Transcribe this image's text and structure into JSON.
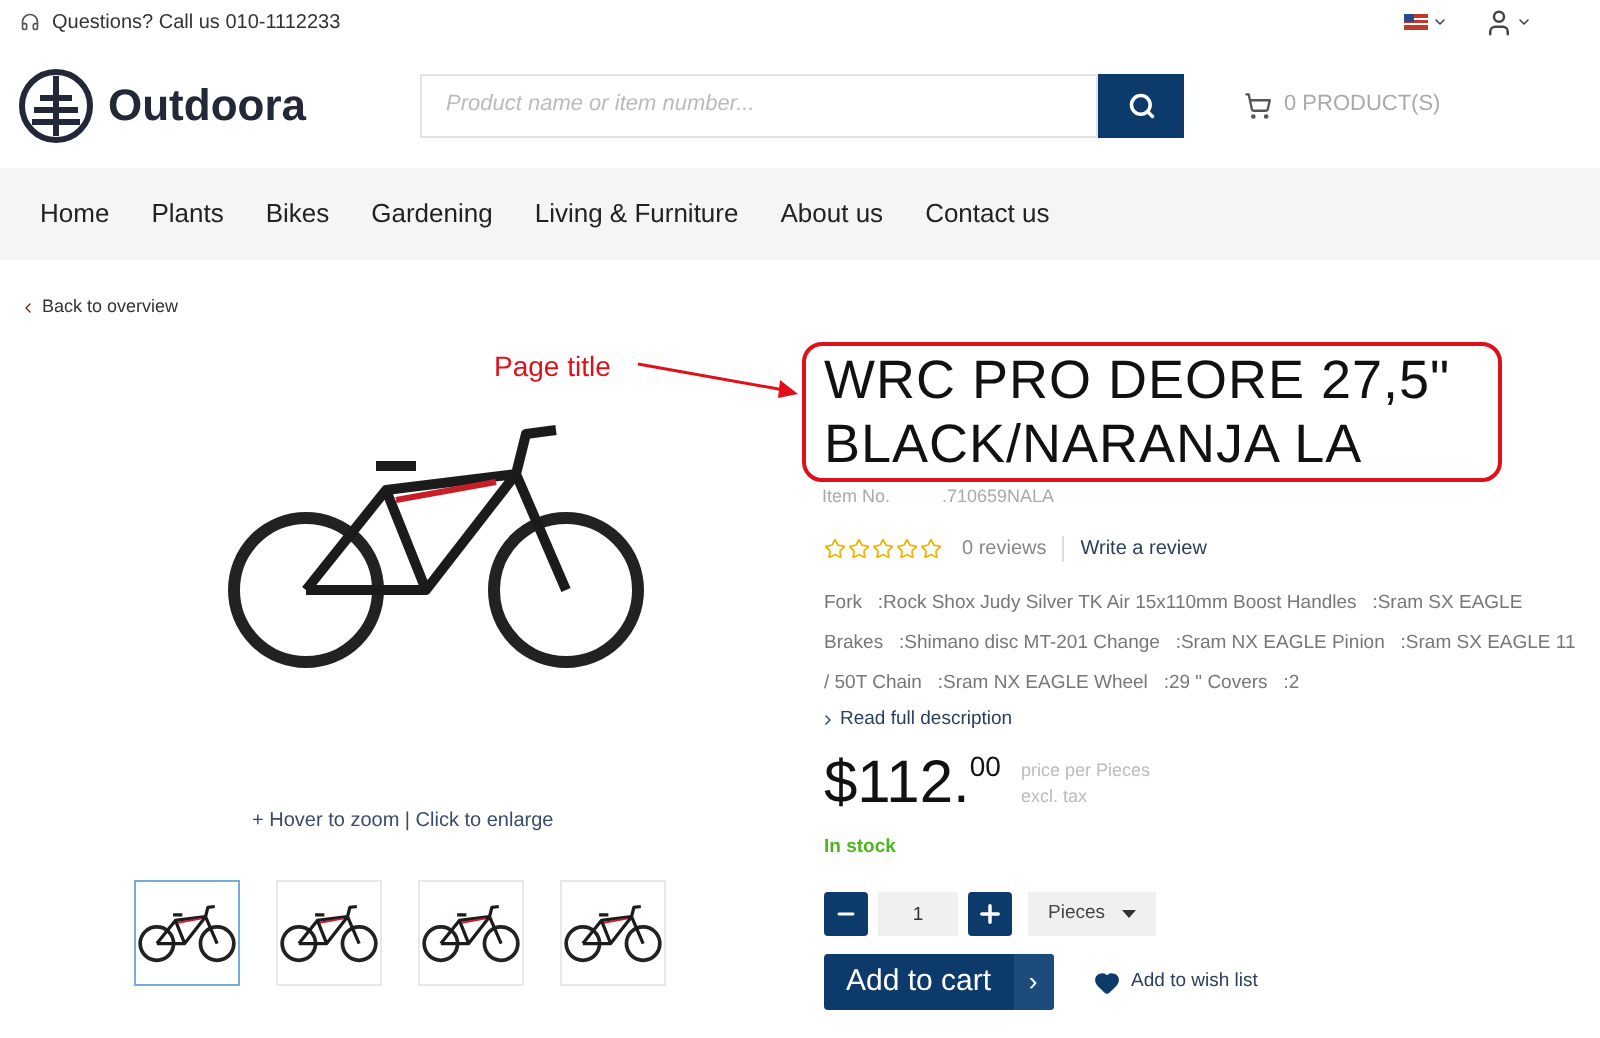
{
  "topbar": {
    "contact": "Questions? Call us 010-1112233"
  },
  "header": {
    "logo": "Outdoora",
    "search": {
      "placeholder": "Product name or item number..."
    },
    "cart": "0 PRODUCT(S)"
  },
  "nav": [
    {
      "label": "Home"
    },
    {
      "label": "Plants"
    },
    {
      "label": "Bikes"
    },
    {
      "label": "Gardening"
    },
    {
      "label": "Living & Furniture"
    },
    {
      "label": "About us"
    },
    {
      "label": "Contact us"
    }
  ],
  "back_link": "Back to overview",
  "annotation": {
    "label": "Page title"
  },
  "gallery": {
    "hint": "+ Hover to zoom | Click to enlarge",
    "thumbnails": [
      {
        "selected": true
      },
      {
        "selected": false
      },
      {
        "selected": false
      },
      {
        "selected": false
      }
    ]
  },
  "product": {
    "title": "WRC PRO DEORE 27,5\" BLACK/NARANJA LA",
    "item_label": "Item No.",
    "item_no": ".710659NALA",
    "stars": 0,
    "reviews": "0 reviews",
    "write_review": "Write a review",
    "description": "Fork   :Rock Shox Judy Silver TK Air 15x110mm Boost Handles   :Sram SX EAGLE Brakes   :Shimano disc MT-201 Change   :Sram NX EAGLE Pinion   :Sram SX EAGLE 11 / 50T Chain   :Sram NX EAGLE Wheel   :29 \" Covers   :2",
    "read_more": "Read full description",
    "price": "$112.$^{00}$",
    "price_unit": "price per Pieces",
    "tax": "excl. tax",
    "stock": "In stock",
    "quantity": "1",
    "unit": "Pieces",
    "add_to_cart": "Add to cart",
    "cart_arrow": "›",
    "wishlist": "Add to wish list"
  }
}
